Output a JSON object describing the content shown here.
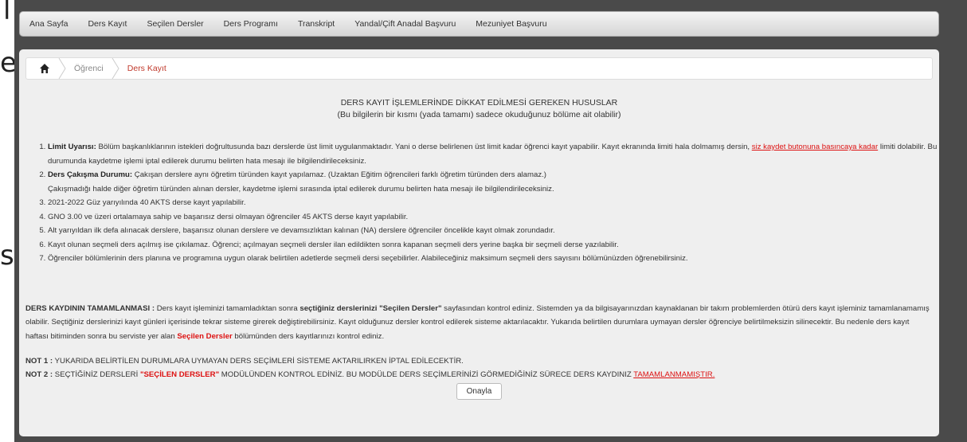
{
  "edge_glyphs": {
    "top": "l",
    "mid": "e",
    "low": "s"
  },
  "nav": {
    "items": [
      "Ana Sayfa",
      "Ders Kayıt",
      "Seçilen Dersler",
      "Ders Programı",
      "Transkript",
      "Yandal/Çift Anadal Başvuru",
      "Mezuniyet Başvuru"
    ]
  },
  "breadcrumb": {
    "home_icon": "home-icon",
    "items": [
      "Öğrenci",
      "Ders Kayıt"
    ]
  },
  "heading": {
    "title": "DERS KAYIT İŞLEMLERİNDE DİKKAT EDİLMESİ GEREKEN HUSUSLAR",
    "subtitle": "(Bu bilgilerin bir kısmı (yada tamamı) sadece okuduğunuz bölüme ait olabilir)"
  },
  "rules": [
    {
      "bold": "Limit Uyarısı:",
      "text": " Bölüm başkanlıklarının istekleri doğrultusunda bazı derslerde üst limit uygulanmaktadır. Yani o derse belirlenen üst limit kadar öğrenci kayıt yapabilir. Kayıt ekranında limiti hala dolmamış dersin, ",
      "link": "siz kaydet butonuna basıncaya kadar",
      "text2": " limiti dolabilir. Bu durumunda kaydetme işlemi iptal edilerek durumu belirten hata mesajı ile bilgilendirileceksiniz."
    },
    {
      "bold": "Ders Çakışma Durumu:",
      "text": " Çakışan derslere aynı öğretim türünden kayıt yapılamaz. (Uzaktan Eğitim öğrencileri farklı öğretim türünden ders alamaz.)",
      "line2": "Çakışmadığı halde diğer öğretim türünden alınan dersler, kaydetme işlemi sırasında iptal edilerek durumu belirten hata mesajı ile bilgilendirileceksiniz."
    },
    {
      "text": "2021-2022 Güz yarıyılında 40 AKTS derse kayıt yapılabilir."
    },
    {
      "text": "GNO 3.00 ve üzeri ortalamaya sahip ve başarısız dersi olmayan öğrenciler 45 AKTS derse kayıt yapılabilir."
    },
    {
      "text": "Alt yarıyıldan ilk defa alınacak derslere, başarısız olunan derslere ve devamsızlıktan kalınan (NA) derslere öğrenciler öncelikle kayıt olmak zorundadır."
    },
    {
      "text": "Kayıt olunan seçmeli ders açılmış ise çıkılamaz. Öğrenci; açılmayan seçmeli dersler ilan edildikten sonra kapanan seçmeli ders yerine başka bir seçmeli derse yazılabilir."
    },
    {
      "text": "Öğrenciler bölümlerinin ders planına ve programına uygun olarak belirtilen adetlerde seçmeli dersi seçebilirler. Alabileceğiniz maksimum seçmeli ders sayısını bölümünüzden öğrenebilirsiniz."
    }
  ],
  "completion": {
    "label": "DERS KAYDININ TAMAMLANMASI :",
    "text1": " Ders kayıt işleminizi tamamladıktan sonra ",
    "bold1": "seçtiğiniz derslerinizi \"Seçilen Dersler\"",
    "text2": " sayfasından kontrol ediniz. Sistemden ya da bilgisayarınızdan kaynaklanan bir takım problemlerden ötürü ders kayıt işleminiz tamamlanamamış olabilir. Seçtiğiniz derslerinizi kayıt günleri içerisinde tekrar sisteme girerek değiştirebilirsiniz. Kayıt olduğunuz dersler kontrol edilerek sisteme aktarılacaktır. Yukarıda belirtilen durumlara uymayan dersler öğrenciye belirtilmeksizin silinecektir. Bu nedenle ders kayıt haftası bitiminden sonra bu serviste yer alan ",
    "red_bold": "Seçilen Dersler",
    "text3": " bölümünden ders kayıtlarınızı kontrol ediniz."
  },
  "notes": {
    "note1_label": "NOT 1 :",
    "note1_text": " YUKARIDA BELİRTİLEN DURUMLARA UYMAYAN DERS SEÇİMLERİ SİSTEME AKTARILIRKEN İPTAL EDİLECEKTİR.",
    "note2_label": "NOT 2 :",
    "note2_text1": " SEÇTİĞİNİZ DERSLERİ ",
    "note2_red": "\"SEÇİLEN DERSLER\"",
    "note2_text2": " MODÜLÜNDEN KONTROL EDİNİZ. BU MODÜLDE DERS SEÇİMLERİNİZİ GÖRMEDİĞİNİZ SÜRECE DERS KAYDINIZ ",
    "note2_link": "TAMAMLANMAMIŞTIR."
  },
  "confirm_button": "Onayla"
}
